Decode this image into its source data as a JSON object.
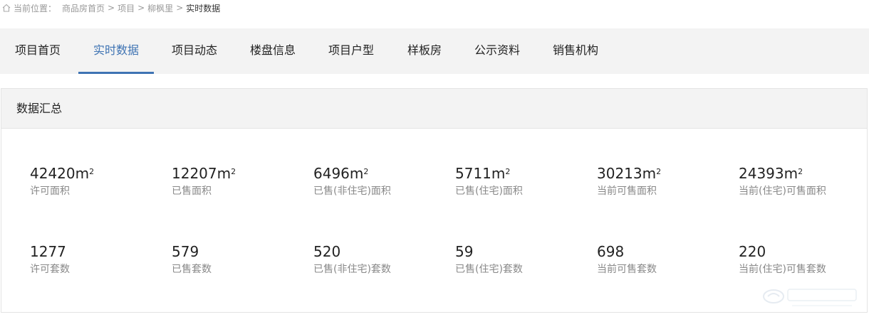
{
  "breadcrumb": {
    "prefix": "当前位置：",
    "items": [
      "商品房首页",
      "项目",
      "柳枫里"
    ],
    "separator": ">",
    "current": "实时数据"
  },
  "nav": {
    "active_color": "#3e73b3",
    "tabs": [
      {
        "label": "项目首页",
        "active": false
      },
      {
        "label": "实时数据",
        "active": true
      },
      {
        "label": "项目动态",
        "active": false
      },
      {
        "label": "楼盘信息",
        "active": false
      },
      {
        "label": "项目户型",
        "active": false
      },
      {
        "label": "样板房",
        "active": false
      },
      {
        "label": "公示资料",
        "active": false
      },
      {
        "label": "销售机构",
        "active": false
      }
    ]
  },
  "summary": {
    "title": "数据汇总",
    "area_unit": "m",
    "area_unit_sup": "2",
    "area_row": [
      {
        "value": "42420",
        "label": "许可面积"
      },
      {
        "value": "12207",
        "label": "已售面积"
      },
      {
        "value": "6496",
        "label": "已售(非住宅)面积"
      },
      {
        "value": "5711",
        "label": "已售(住宅)面积"
      },
      {
        "value": "30213",
        "label": "当前可售面积"
      },
      {
        "value": "24393",
        "label": "当前(住宅)可售面积"
      }
    ],
    "count_row": [
      {
        "value": "1277",
        "label": "许可套数"
      },
      {
        "value": "579",
        "label": "已售套数"
      },
      {
        "value": "520",
        "label": "已售(非住宅)套数"
      },
      {
        "value": "59",
        "label": "已售(住宅)套数"
      },
      {
        "value": "698",
        "label": "当前可售套数"
      },
      {
        "value": "220",
        "label": "当前(住宅)可售套数"
      }
    ]
  }
}
